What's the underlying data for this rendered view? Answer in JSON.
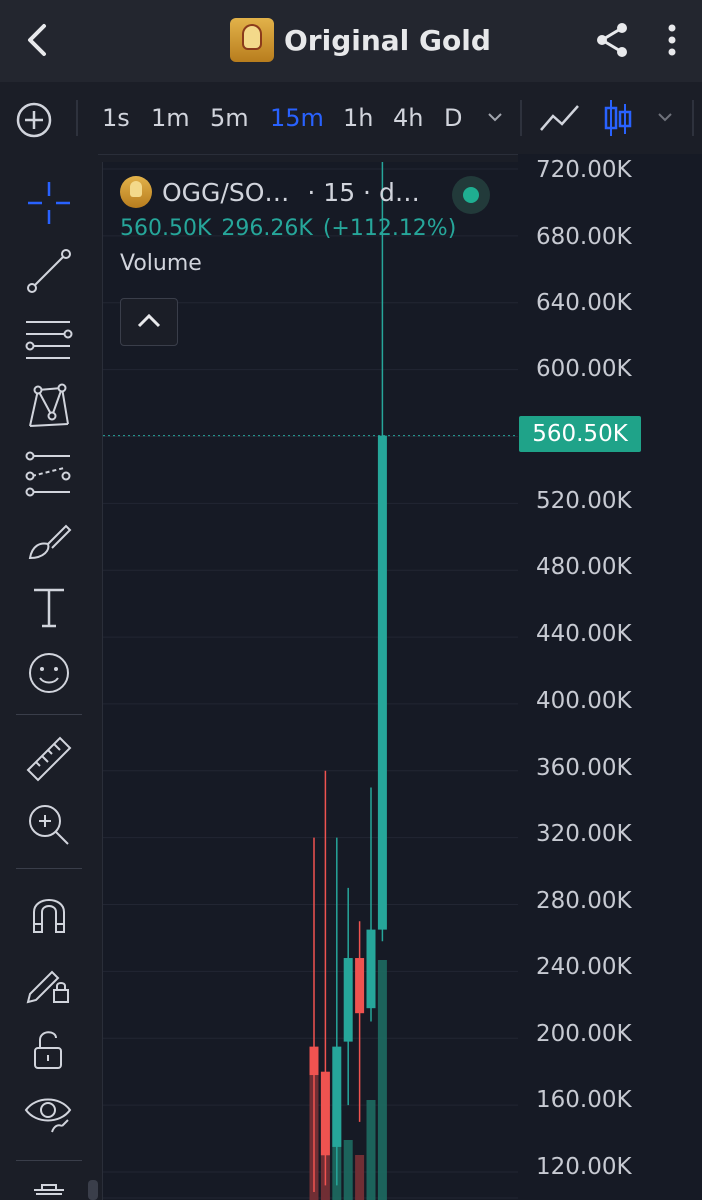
{
  "header": {
    "title": "Original Gold",
    "back_icon": "chevron-left-icon",
    "share_icon": "share-icon",
    "menu_icon": "more-vertical-icon"
  },
  "toolbar": {
    "add_icon": "plus-circle-icon",
    "timeframes": [
      "1s",
      "1m",
      "5m",
      "15m",
      "1h",
      "4h",
      "D"
    ],
    "active_timeframe": "15m",
    "chart_type_icons": [
      "line-chart-icon",
      "candlestick-icon"
    ]
  },
  "legend": {
    "symbol": "OGG/SO…",
    "meta": "· 15 · d…",
    "price": "560.50K",
    "change": "296.26K",
    "change_pct": "(+112.12%)",
    "study": "Volume"
  },
  "price_axis": {
    "ticks": [
      "720.00K",
      "680.00K",
      "640.00K",
      "600.00K",
      "560.50K",
      "520.00K",
      "480.00K",
      "440.00K",
      "400.00K",
      "360.00K",
      "320.00K",
      "280.00K",
      "240.00K",
      "200.00K",
      "160.00K",
      "120.00K"
    ],
    "last_price": "560.50K"
  },
  "colors": {
    "up": "#26a69a",
    "down": "#ef5350",
    "accent": "#2962ff",
    "background": "#161a25"
  },
  "chart_data": {
    "type": "candlestick",
    "ylim": [
      112000,
      736000
    ],
    "candles": [
      {
        "open": 195000,
        "high": 320000,
        "low": 108000,
        "close": 178000
      },
      {
        "open": 180000,
        "high": 360000,
        "low": 112000,
        "close": 130000
      },
      {
        "open": 135000,
        "high": 320000,
        "low": 112000,
        "close": 195000
      },
      {
        "open": 198000,
        "high": 290000,
        "low": 160000,
        "close": 248000
      },
      {
        "open": 248000,
        "high": 270000,
        "low": 150000,
        "close": 215000
      },
      {
        "open": 218000,
        "high": 350000,
        "low": 210000,
        "close": 265000
      },
      {
        "open": 265000,
        "high": 736000,
        "low": 258000,
        "close": 560500
      }
    ],
    "volume": [
      0.3,
      0.24,
      0.18,
      0.12,
      0.09,
      0.2,
      0.48
    ]
  }
}
